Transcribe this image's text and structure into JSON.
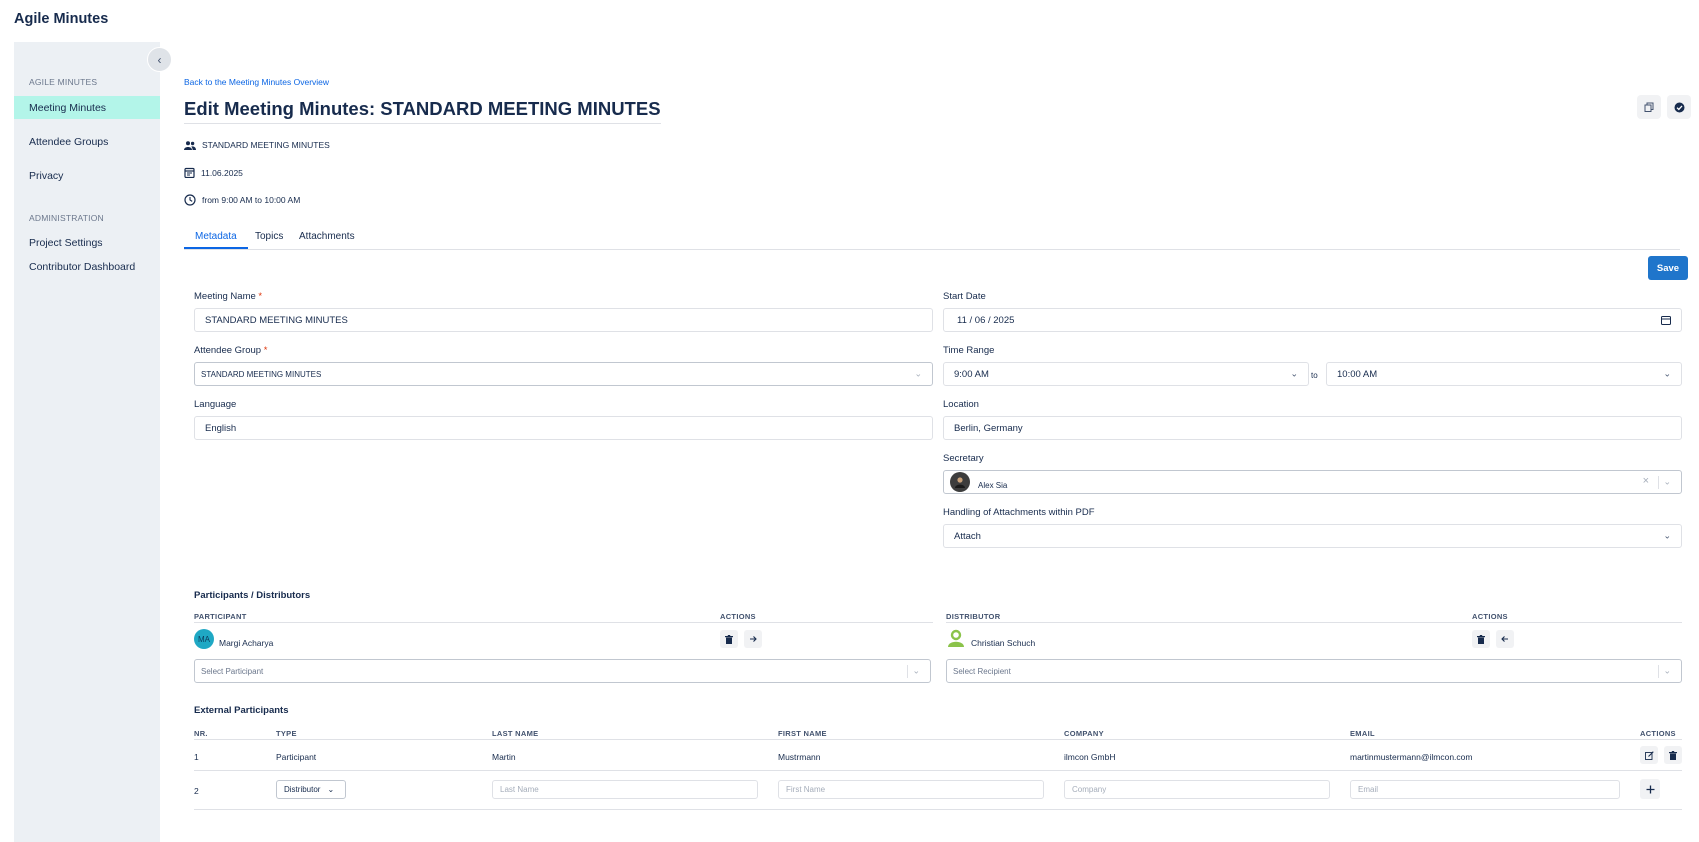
{
  "app": {
    "title": "Agile Minutes"
  },
  "sidebar": {
    "collapse_icon": "‹",
    "sections": [
      {
        "title": "AGILE MINUTES",
        "items": [
          {
            "label": "Meeting Minutes",
            "active": true
          },
          {
            "label": "Attendee Groups"
          },
          {
            "label": "Privacy"
          }
        ]
      },
      {
        "title": "ADMINISTRATION",
        "items": [
          {
            "label": "Project Settings"
          },
          {
            "label": "Contributor Dashboard"
          }
        ]
      }
    ]
  },
  "header": {
    "back_link": "Back to the Meeting Minutes Overview",
    "title": "Edit Meeting Minutes: STANDARD MEETING MINUTES",
    "meta": {
      "group": "STANDARD MEETING MINUTES",
      "date": "11.06.2025",
      "time": "from 9:00 AM to 10:00 AM"
    }
  },
  "tabs": [
    {
      "label": "Metadata",
      "active": true
    },
    {
      "label": "Topics"
    },
    {
      "label": "Attachments"
    }
  ],
  "save_label": "Save",
  "form": {
    "meeting_name": {
      "label": "Meeting Name",
      "required_mark": "*",
      "value": "STANDARD MEETING MINUTES"
    },
    "attendee_group": {
      "label": "Attendee Group",
      "required_mark": "*",
      "value": "STANDARD MEETING MINUTES"
    },
    "language": {
      "label": "Language",
      "value": "English"
    },
    "start_date": {
      "label": "Start Date",
      "value": "11 / 06 / 2025"
    },
    "time_range": {
      "label": "Time Range",
      "from": "9:00 AM",
      "to_label": "to",
      "to": "10:00 AM"
    },
    "location": {
      "label": "Location",
      "value": "Berlin, Germany"
    },
    "secretary": {
      "label": "Secretary",
      "value": "Alex Sia"
    },
    "pdf_handling": {
      "label": "Handling of Attachments within PDF",
      "value": "Attach"
    }
  },
  "participants": {
    "title": "Participants / Distributors",
    "participant_header": "PARTICIPANT",
    "actions_header": "ACTIONS",
    "distributor_header": "DISTRIBUTOR",
    "participant": {
      "initials": "MA",
      "name": "Margi Acharya",
      "avatar_color": "#1fa8c4"
    },
    "distributor": {
      "name": "Christian Schuch",
      "avatar_color": "#8bc34a"
    },
    "select_participant_placeholder": "Select Participant",
    "select_recipient_placeholder": "Select Recipient"
  },
  "external": {
    "title": "External Participants",
    "columns": [
      "NR.",
      "TYPE",
      "LAST NAME",
      "FIRST NAME",
      "COMPANY",
      "EMAIL",
      "ACTIONS"
    ],
    "rows": [
      {
        "nr": "1",
        "type": "Participant",
        "last_name": "Martin",
        "first_name": "Mustrmann",
        "company": "ilmcon GmbH",
        "email": "martinmustermann@ilmcon.com"
      }
    ],
    "new_row": {
      "nr": "2",
      "type": "Distributor",
      "last_name_placeholder": "Last Name",
      "first_name_placeholder": "First Name",
      "company_placeholder": "Company",
      "email_placeholder": "Email"
    }
  },
  "colors": {
    "accent": "#1f75cb",
    "active_nav": "#b3f5e9",
    "sidebar_bg": "#ecf0f4"
  }
}
